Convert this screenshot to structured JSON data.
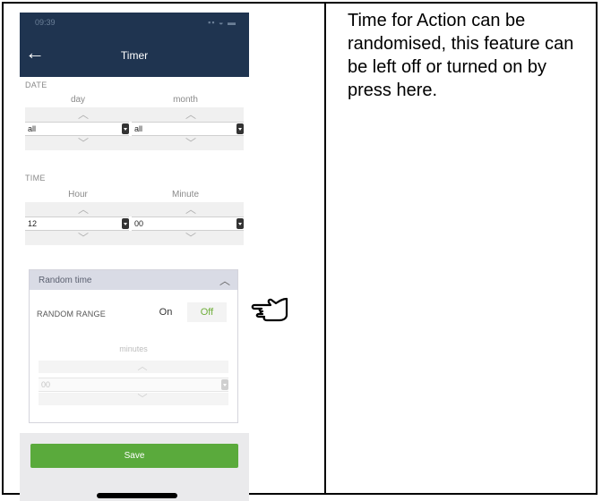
{
  "status_bar": {
    "time": "09:39",
    "icons": "signal-wifi-battery"
  },
  "header": {
    "title": "Timer",
    "back_icon": "arrow-left-icon"
  },
  "date_section": {
    "label": "DATE",
    "day_label": "day",
    "month_label": "month",
    "day_value": "all",
    "month_value": "all"
  },
  "time_section": {
    "label": "TIME",
    "hour_label": "Hour",
    "minute_label": "Minute",
    "hour_value": "12",
    "minute_value": "00"
  },
  "random_time": {
    "title": "Random time",
    "range_label": "RANDOM RANGE",
    "on_label": "On",
    "off_label": "Off",
    "minutes_label": "minutes",
    "minutes_value": "00"
  },
  "save_label": "Save",
  "caption": "Time for Action can be randomised, this feature can be left off or turned on by press here.",
  "colors": {
    "nav": "#1f3450",
    "accent_green": "#5aaa3c",
    "off_green": "#6fae3a"
  }
}
